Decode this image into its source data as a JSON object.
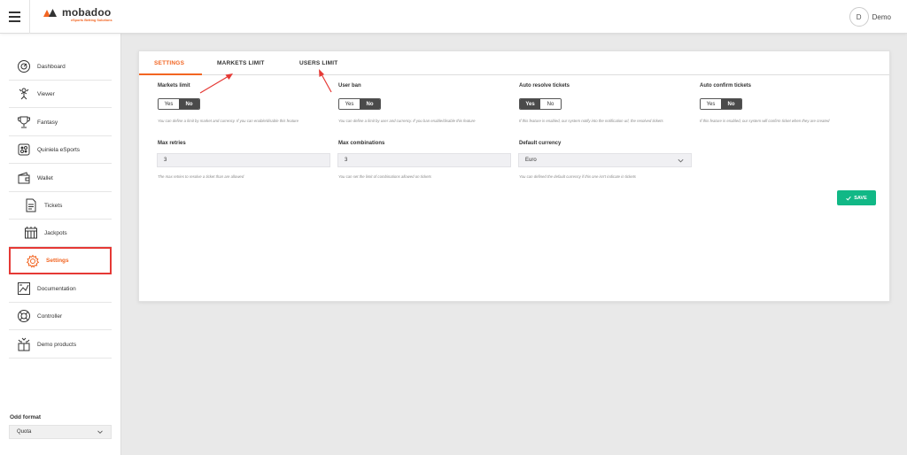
{
  "app": {
    "logo_name": "mobadoo",
    "logo_tagline": "eSports Betting Solutions"
  },
  "user": {
    "initial": "D",
    "name": "Demo"
  },
  "sidebar": {
    "items": [
      {
        "label": "Dashboard",
        "icon": "dashboard-icon"
      },
      {
        "label": "Viewer",
        "icon": "viewer-icon"
      },
      {
        "label": "Fantasy",
        "icon": "trophy-icon"
      },
      {
        "label": "Quiniela eSports",
        "icon": "quiniela-icon"
      },
      {
        "label": "Wallet",
        "icon": "wallet-icon"
      },
      {
        "label": "Tickets",
        "icon": "ticket-icon"
      },
      {
        "label": "Jackpots",
        "icon": "jackpot-icon"
      },
      {
        "label": "Settings",
        "icon": "gear-icon"
      },
      {
        "label": "Documentation",
        "icon": "documentation-icon"
      },
      {
        "label": "Controller",
        "icon": "lifebuoy-icon"
      },
      {
        "label": "Demo products",
        "icon": "gift-icon"
      }
    ],
    "odd_format": {
      "title": "Odd format",
      "value": "Quota"
    }
  },
  "tabs": [
    {
      "label": "SETTINGS",
      "active": true
    },
    {
      "label": "MARKETS LIMIT",
      "active": false
    },
    {
      "label": "USERS LIMIT",
      "active": false
    }
  ],
  "settings": {
    "markets_limit": {
      "label": "Markets limit",
      "yes": "Yes",
      "no": "No",
      "selected": "No",
      "help": "You can define a limit by market and currency. If you can enable/disable this feature"
    },
    "user_ban": {
      "label": "User ban",
      "yes": "Yes",
      "no": "No",
      "selected": "No",
      "help": "You can define a limit by user and currency. If you ban enable/disable this feature"
    },
    "auto_resolve": {
      "label": "Auto resolve tickets",
      "yes": "Yes",
      "no": "No",
      "selected": "Yes",
      "help": "If this feature is enabled, our system notify into the notification url, the resolved tickets"
    },
    "auto_confirm": {
      "label": "Auto confirm tickets",
      "yes": "Yes",
      "no": "No",
      "selected": "No",
      "help": "If this feature is enabled, our system will confirm ticket when they are created"
    },
    "max_retries": {
      "label": "Max retries",
      "value": "3",
      "help": "The max retries to resolve a ticket than are allowed"
    },
    "max_combinations": {
      "label": "Max combinations",
      "value": "3",
      "help": "You can set the limit of combinations allowed on tickets"
    },
    "default_currency": {
      "label": "Default currency",
      "value": "Euro",
      "help": "You can defined the default currency if this one isn't indicate in tickets"
    }
  },
  "save_label": "SAVE",
  "colors": {
    "accent": "#f26522",
    "save": "#11b886",
    "highlight": "#e53935"
  }
}
